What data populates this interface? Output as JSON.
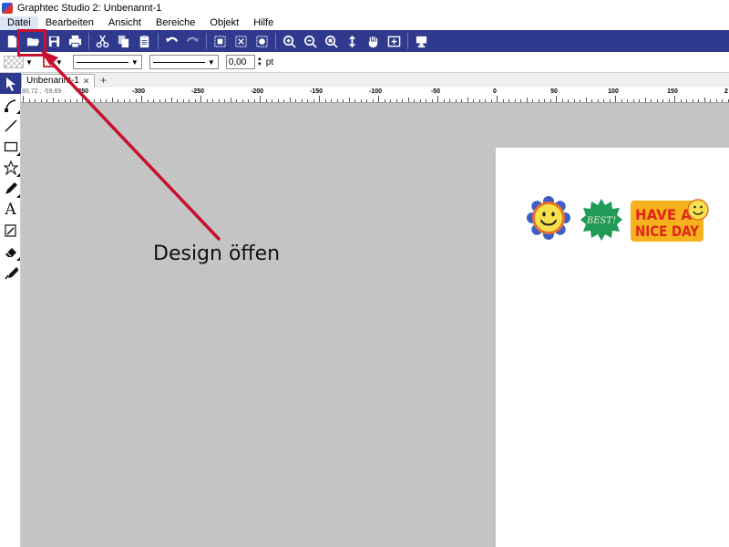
{
  "window": {
    "title": "Graphtec Studio 2: Unbenannt-1"
  },
  "menubar": {
    "items": [
      {
        "label": "Datei",
        "active": true
      },
      {
        "label": "Bearbeiten"
      },
      {
        "label": "Ansicht"
      },
      {
        "label": "Bereiche"
      },
      {
        "label": "Objekt"
      },
      {
        "label": "Hilfe"
      }
    ]
  },
  "toolbar": {
    "buttons": [
      "new-document-icon",
      "open-folder-icon",
      "save-icon",
      "print-icon",
      "cut-icon",
      "copy-icon",
      "paste-icon",
      "undo-icon",
      "redo-icon",
      "group-icon",
      "ungroup-icon",
      "trace-icon",
      "zoom-in-icon",
      "zoom-out-icon",
      "zoom-fit-icon",
      "move-icon",
      "pan-hand-icon",
      "zoom-page-icon",
      "send-to-cutter-icon"
    ]
  },
  "properties": {
    "stroke_color": "#d4303c",
    "line_width_value": "0,00",
    "line_width_unit": "pt"
  },
  "tabs": [
    {
      "label": "Unbenannt-1"
    }
  ],
  "ruler": {
    "coords": "80,72 , -59,69",
    "labels": [
      "-350",
      "-300",
      "-250",
      "-200",
      "-150",
      "-100",
      "-50",
      "0",
      "50",
      "100",
      "150",
      "2"
    ]
  },
  "tools": [
    "select-arrow-icon",
    "node-edit-icon",
    "line-tool-icon",
    "rectangle-tool-icon",
    "star-tool-icon",
    "pencil-tool-icon",
    "text-tool-icon",
    "trace-image-icon",
    "eraser-tool-icon",
    "knife-tool-icon"
  ],
  "stickers": {
    "best_text": "BEST!",
    "nice_line1": "HAVE A",
    "nice_line2": "NICE DAY"
  },
  "annotation": {
    "text": "Design öffen",
    "color": "#c8102e"
  },
  "colors": {
    "toolbar_bg": "#2f3a8f",
    "canvas_bg": "#c4c4c4"
  }
}
